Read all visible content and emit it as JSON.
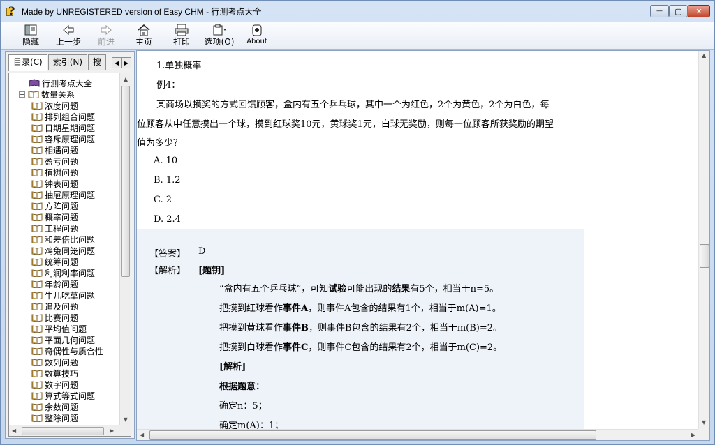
{
  "window": {
    "title": "Made by UNREGISTERED version of Easy CHM - 行测考点大全",
    "minimize_glyph": "—",
    "maximize_glyph": "▢",
    "close_glyph": "✕"
  },
  "toolbar": {
    "hide": "隐藏",
    "back": "上一步",
    "forward": "前进",
    "home": "主页",
    "print": "打印",
    "options": "选项(O)",
    "about": "About"
  },
  "tabs": {
    "contents": "目录(C)",
    "index": "索引(N)",
    "search": "搜"
  },
  "tree": {
    "root": "行测考点大全",
    "folder": "数量关系",
    "items": [
      "浓度问题",
      "排列组合问题",
      "日期星期问题",
      "容斥原理问题",
      "相遇问题",
      "盈亏问题",
      "植树问题",
      "钟表问题",
      "抽屉原理问题",
      "方阵问题",
      "概率问题",
      "工程问题",
      "和差倍比问题",
      "鸡兔同笼问题",
      "统筹问题",
      "利润利率问题",
      "年龄问题",
      "牛儿吃草问题",
      "追及问题",
      "比赛问题",
      "平均值问题",
      "平面几何问题",
      "奇偶性与质合性",
      "数列问题",
      "数算技巧",
      "数字问题",
      "算式等式问题",
      "余数问题",
      "整除问题"
    ]
  },
  "doc": {
    "heading": "1.单独概率",
    "example": "例4：",
    "q1": "某商场以摸奖的方式回馈顾客，盒内有五个乒乓球，其中一个为红色，2个为黄色，2个为白色，每",
    "q2": "位顾客从中任意摸出一个球，摸到红球奖10元，黄球奖1元，白球无奖励，则每一位顾客所获奖励的期望",
    "q3": "值为多少？",
    "options": [
      "A. 10",
      "B. 1.2",
      "C. 2",
      "D. 2.4"
    ],
    "answer_label": "【答案】",
    "answer_value": "D",
    "analysis_label": "【解析】",
    "analysis_title": "[题钥]",
    "s1a": "“盒内有五个乒乓球”，可知",
    "s1b": "试验",
    "s1c": "可能出现的",
    "s1d": "结果",
    "s1e": "有5个，相当于n=5。",
    "s2a": "把摸到红球看作",
    "s2b": "事件A",
    "s2c": "，则事件A包含的结果有1个，相当于m(A)=1。",
    "s3a": "把摸到黄球看作",
    "s3b": "事件B",
    "s3c": "，则事件B包含的结果有2个，相当于m(B)=2。",
    "s4a": "把摸到白球看作",
    "s4b": "事件C",
    "s4c": "，则事件C包含的结果有2个，相当于m(C)=2。",
    "parse": "[解析]",
    "basis": "根据题意：",
    "d1": "确定n：5；",
    "d2": "确定m(A)：1；"
  }
}
